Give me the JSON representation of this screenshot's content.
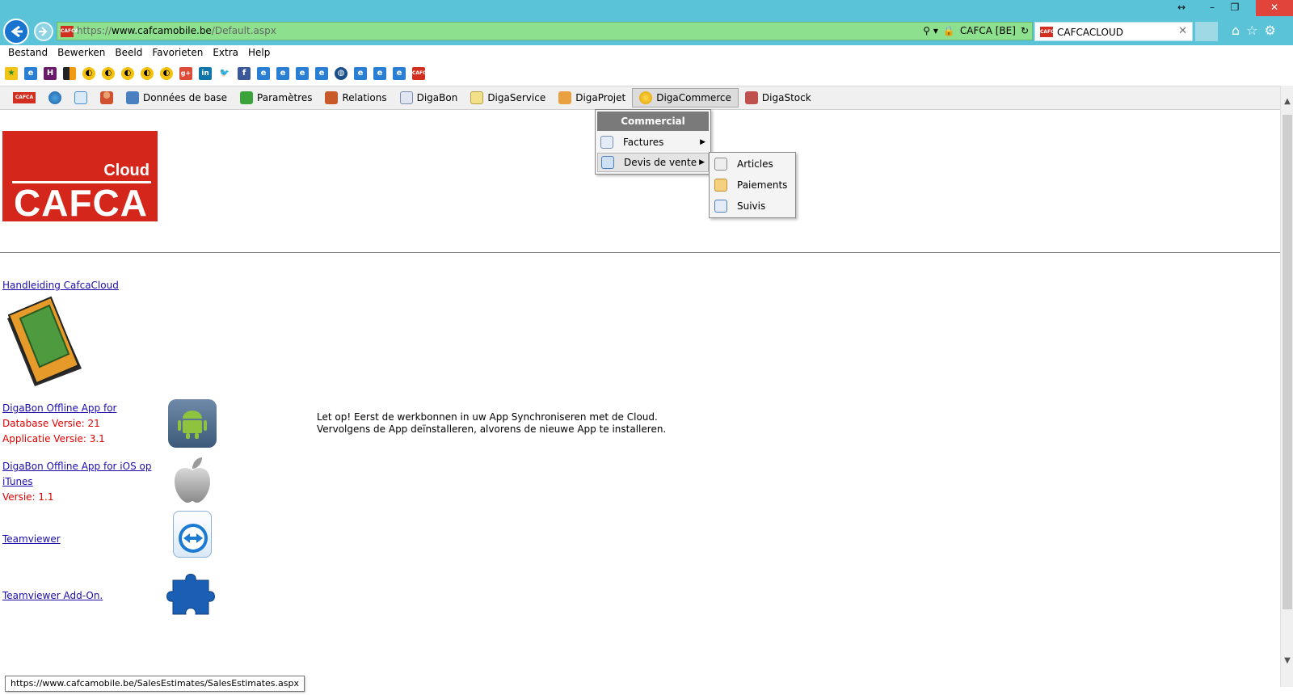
{
  "browser": {
    "address_scheme": "https://",
    "address_host": "www.cafcamobile.be",
    "address_path": "/Default.aspx",
    "site_identity": "CAFCA [BE]",
    "tab_title": "CAFCACLOUD",
    "fav_label": "CAFCA"
  },
  "menubar": [
    "Bestand",
    "Bewerken",
    "Beeld",
    "Favorieten",
    "Extra",
    "Help"
  ],
  "app_menu": {
    "items": [
      "Données de base",
      "Paramètres",
      "Relations",
      "DigaBon",
      "DigaService",
      "DigaProjet",
      "DigaCommerce",
      "DigaStock"
    ],
    "active": "DigaCommerce",
    "colors": {
      "cafca_red": "#d5261b",
      "bar_bg": "#f0f0f0"
    }
  },
  "dropdown": {
    "header": "Commercial",
    "items": [
      "Factures",
      "Devis de vente"
    ],
    "submenu": [
      "Articles",
      "Paiements",
      "Suivis"
    ]
  },
  "logo": {
    "top": "Cloud",
    "name": "CAFCA"
  },
  "content": {
    "manual_link": "Handleiding CafcaCloud",
    "android_link": "DigaBon Offline App for",
    "android_db": "Database Versie: 21",
    "android_app": "Applicatie Versie: 3.1",
    "ios_link_1": "DigaBon Offline App for iOS op",
    "ios_link_2": "iTunes",
    "ios_version": "Versie: 1.1",
    "teamviewer": "Teamviewer",
    "teamviewer_addon": "Teamviewer Add-On.",
    "note_line1": "Let op! Eerst de werkbonnen in uw App Synchroniseren met de Cloud.",
    "note_line2": "Vervolgens de App deïnstalleren, alvorens de nieuwe App te installeren."
  },
  "status_url": "https://www.cafcamobile.be/SalesEstimates/SalesEstimates.aspx"
}
